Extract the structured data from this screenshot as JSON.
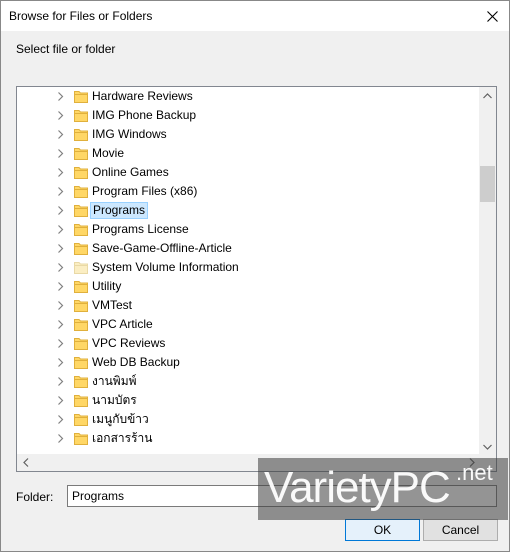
{
  "window": {
    "title": "Browse for Files or Folders"
  },
  "instruction": "Select file or folder",
  "tree": {
    "items": [
      {
        "label": "Hardware Reviews",
        "selected": false,
        "dim": false
      },
      {
        "label": "IMG Phone Backup",
        "selected": false,
        "dim": false
      },
      {
        "label": "IMG Windows",
        "selected": false,
        "dim": false
      },
      {
        "label": "Movie",
        "selected": false,
        "dim": false
      },
      {
        "label": "Online Games",
        "selected": false,
        "dim": false
      },
      {
        "label": "Program Files (x86)",
        "selected": false,
        "dim": false
      },
      {
        "label": "Programs",
        "selected": true,
        "dim": false
      },
      {
        "label": "Programs License",
        "selected": false,
        "dim": false
      },
      {
        "label": "Save-Game-Offline-Article",
        "selected": false,
        "dim": false
      },
      {
        "label": "System Volume Information",
        "selected": false,
        "dim": true
      },
      {
        "label": "Utility",
        "selected": false,
        "dim": false
      },
      {
        "label": "VMTest",
        "selected": false,
        "dim": false
      },
      {
        "label": "VPC Article",
        "selected": false,
        "dim": false
      },
      {
        "label": "VPC Reviews",
        "selected": false,
        "dim": false
      },
      {
        "label": "Web DB Backup",
        "selected": false,
        "dim": false
      },
      {
        "label": "งานพิมพ์",
        "selected": false,
        "dim": false
      },
      {
        "label": "นามบัตร",
        "selected": false,
        "dim": false
      },
      {
        "label": "เมนูกับข้าว",
        "selected": false,
        "dim": false
      },
      {
        "label": "เอกสารร้าน",
        "selected": false,
        "dim": false
      }
    ]
  },
  "folder": {
    "label": "Folder:",
    "value": "Programs"
  },
  "buttons": {
    "ok": "OK",
    "cancel": "Cancel"
  },
  "watermark": {
    "main": "VarietyPC",
    "suffix": ".net"
  },
  "colors": {
    "folder_fill": "#ffd766",
    "folder_dim": "#fbeec3",
    "selection": "#cce8ff",
    "accent": "#0078d7"
  }
}
